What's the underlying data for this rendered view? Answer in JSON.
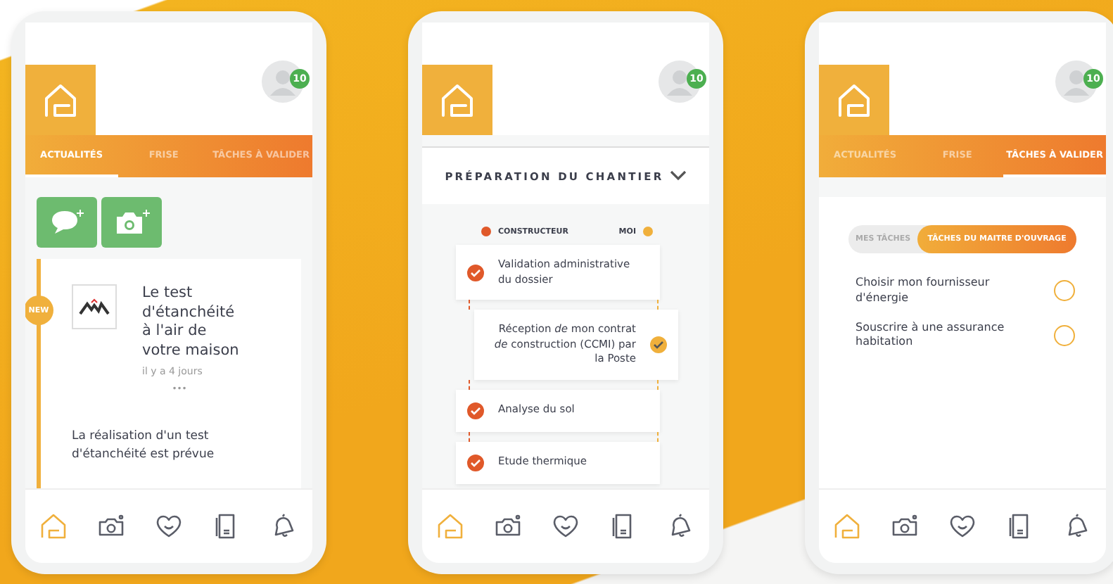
{
  "phones": [
    {
      "kind": "feed",
      "avatar_badge": "10",
      "tabs": [
        {
          "label": "ACTUALITÉS",
          "selected": true
        },
        {
          "label": "FRISE",
          "selected": false
        },
        {
          "label": "TÂCHES À VALIDER",
          "selected": false
        }
      ],
      "post": {
        "badge": "NEW",
        "title": "Le test d'étanchéité à l'air de votre maison",
        "time": "il y a 4 jours",
        "more": "•••",
        "excerpt": "La réalisation d'un test d'étanchéité est prévue"
      },
      "nav": [
        {
          "selected": true
        },
        {
          "selected": false
        },
        {
          "selected": false
        },
        {
          "selected": false
        },
        {
          "selected": false
        }
      ]
    },
    {
      "kind": "timeline",
      "avatar_badge": "10",
      "section_title": "PRÉPARATION DU CHANTIER",
      "legend": [
        {
          "label": "CONSTRUCTEUR",
          "color": "#e0592a"
        },
        {
          "label": "MOI",
          "color": "#f0b03c"
        }
      ],
      "steps": [
        {
          "kind": "builder",
          "text": "Validation administrative du dossier",
          "done": true
        },
        {
          "kind": "owner",
          "text": "Réception *de* mon contrat *de* construction (CCMI) par la Poste",
          "done": true
        },
        {
          "kind": "builder",
          "text": "Analyse du sol",
          "done": true
        },
        {
          "kind": "builder",
          "text": "Etude thermique",
          "done": true
        }
      ],
      "nav": [
        {
          "selected": true
        },
        {
          "selected": false
        },
        {
          "selected": false
        },
        {
          "selected": false
        },
        {
          "selected": false
        }
      ]
    },
    {
      "kind": "tasks",
      "avatar_badge": "10",
      "tabs": [
        {
          "label": "ACTUALITÉS",
          "selected": false
        },
        {
          "label": "FRISE",
          "selected": false
        },
        {
          "label": "TÂCHES À VALIDER",
          "selected": true
        }
      ],
      "segments": [
        {
          "label": "MES TÂCHES",
          "selected": false
        },
        {
          "label": "TÂCHES DU MAITRE D'OUVRAGE",
          "selected": true
        }
      ],
      "tasks": [
        {
          "text": "Choisir mon fournisseur d'énergie",
          "checked": false
        },
        {
          "text": "Souscrire à une assurance habitation",
          "checked": false
        }
      ],
      "nav": [
        {
          "selected": true
        },
        {
          "selected": false
        },
        {
          "selected": false
        },
        {
          "selected": false
        },
        {
          "selected": false
        }
      ]
    }
  ]
}
